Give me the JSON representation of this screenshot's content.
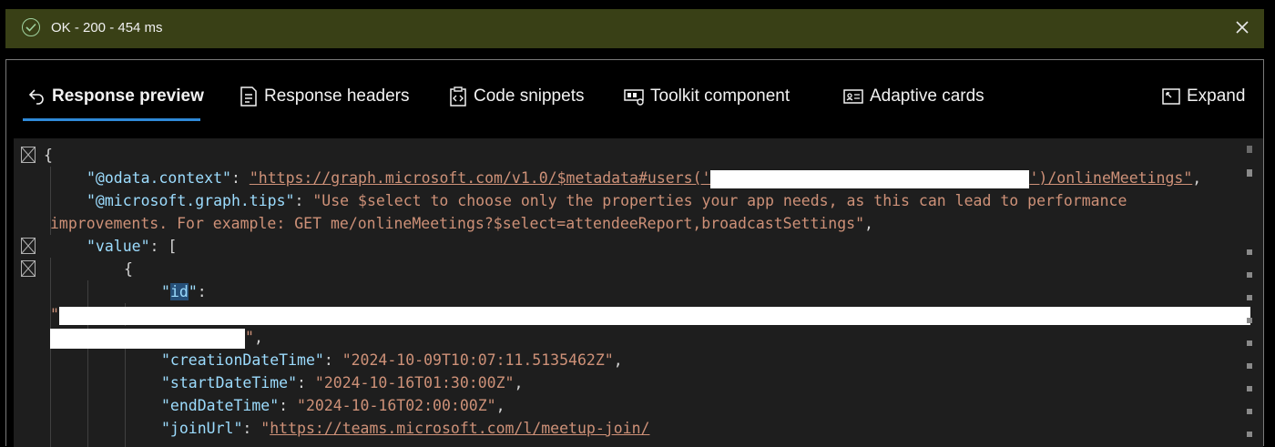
{
  "status": {
    "text": "OK - 200 - 454 ms",
    "color": "#394016"
  },
  "tabs": [
    {
      "label": "Response preview",
      "icon": "undo-arrow-icon",
      "active": true
    },
    {
      "label": "Response headers",
      "icon": "document-list-icon"
    },
    {
      "label": "Code snippets",
      "icon": "clipboard-code-icon"
    },
    {
      "label": "Toolkit component",
      "icon": "component-icon"
    },
    {
      "label": "Adaptive cards",
      "icon": "contact-card-icon"
    },
    {
      "label": "Expand",
      "icon": "expand-icon"
    }
  ],
  "json": {
    "open_brace": "{",
    "odata_key": "\"@odata.context\"",
    "odata_url_pre": "\"https://graph.microsoft.com/v1.0/$metadata#users('",
    "odata_url_post": "')/onlineMeetings\"",
    "tips_key": "\"@microsoft.graph.tips\"",
    "tips_val_1": "\"Use $select to choose only the properties your app needs, as this can lead to performance",
    "tips_val_2": "improvements. For example: GET me/onlineMeetings?$select=attendeeReport,broadcastSettings\"",
    "value_key": "\"value\"",
    "value_open": "[",
    "obj_open": "{",
    "id_key_q1": "\"",
    "id_key_word": "id",
    "id_key_q2": "\"",
    "creation_key": "\"creationDateTime\"",
    "creation_val": "\"2024-10-09T10:07:11.5135462Z\"",
    "start_key": "\"startDateTime\"",
    "start_val": "\"2024-10-16T01:30:00Z\"",
    "end_key": "\"endDateTime\"",
    "end_val": "\"2024-10-16T02:00:00Z\"",
    "join_key": "\"joinUrl\"",
    "join_val": "https://teams.microsoft.com/l/meetup-join/"
  }
}
